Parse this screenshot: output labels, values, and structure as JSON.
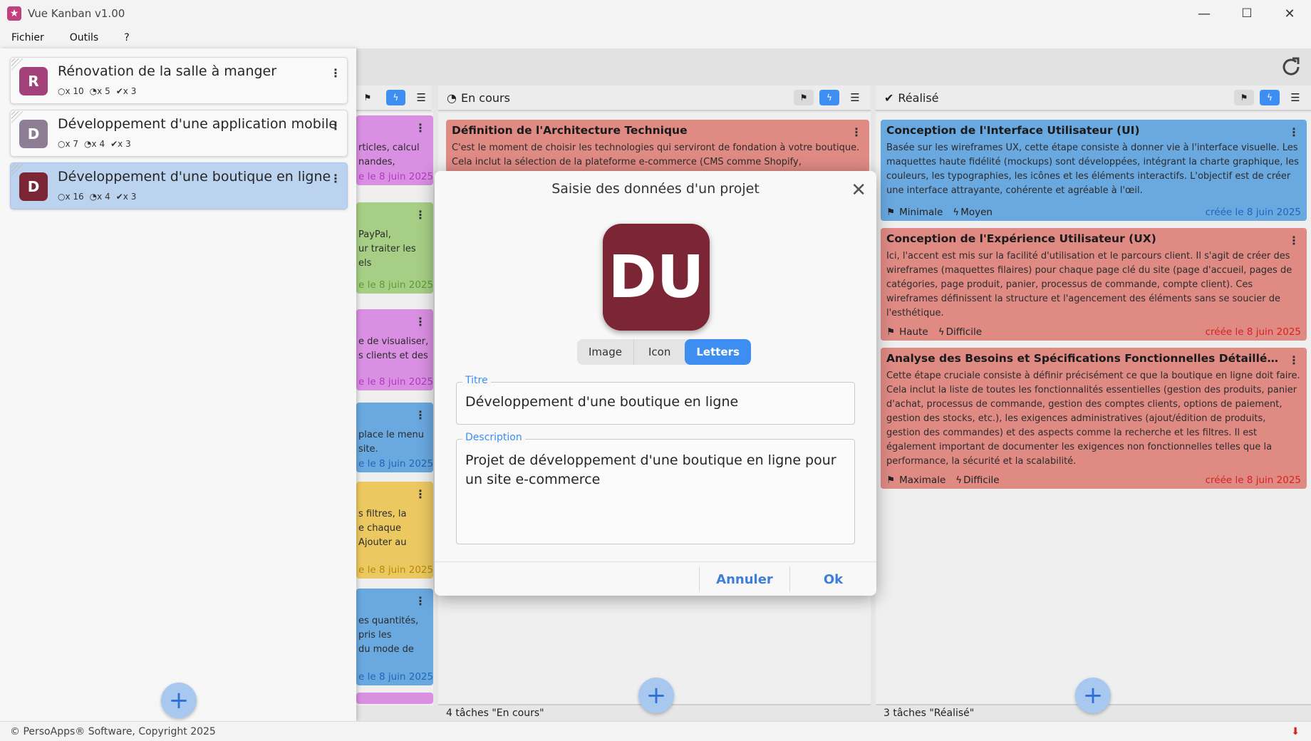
{
  "window": {
    "title": "Vue Kanban v1.00",
    "minimize": "—",
    "maximize": "☐",
    "close": "✕"
  },
  "menu": [
    "Fichier",
    "Outils",
    "?"
  ],
  "statusbar": {
    "text": "© PersoApps® Software, Copyright 2025"
  },
  "projects": [
    {
      "letter": "R",
      "title": "Rénovation de la salle à manger",
      "todo": "x 10",
      "doing": "x 5",
      "done": "x 3",
      "color": "#a3427a"
    },
    {
      "letter": "D",
      "title": "Développement d'une application mobile",
      "todo": "x 7",
      "doing": "x 4",
      "done": "x 3",
      "color": "#8e7e95"
    },
    {
      "letter": "D",
      "title": "Développement d'une boutique en ligne",
      "todo": "x 16",
      "doing": "x 4",
      "done": "x 3",
      "color": "#7b2535"
    }
  ],
  "left_cards": [
    {
      "text1": "rticles, calcul",
      "text2": "nandes,",
      "date": "e le 8 juin 2025",
      "color": "#d98fe2",
      "datecolor": "#b33ac4"
    },
    {
      "text1": "PayPal,",
      "text2": "ur traiter les",
      "text3": "els",
      "date": "e le 8 juin 2025",
      "color": "#a6cf85",
      "datecolor": "#5e9c33"
    },
    {
      "text1": "e de visualiser,",
      "text2": "s clients et des",
      "date": "e le 8 juin 2025",
      "color": "#d98fe2",
      "datecolor": "#b33ac4"
    },
    {
      "text1": "place le menu",
      "text2": "site.",
      "date": "e le 8 juin 2025",
      "color": "#6aa8e0",
      "datecolor": "#1f67b7"
    },
    {
      "text1": "s filtres, la",
      "text2": "e chaque",
      "text3": "Ajouter au",
      "date": "e le 8 juin 2025",
      "color": "#ecc861",
      "datecolor": "#b88a09"
    },
    {
      "text1": "es quantités,",
      "text2": "pris les",
      "text3": "du mode de",
      "date": "e le 8 juin 2025",
      "color": "#6aa8e0",
      "datecolor": "#1f67b7"
    }
  ],
  "columns": {
    "en_cours": {
      "title": "En cours",
      "footer": "4 tâches \"En cours\""
    },
    "realise": {
      "title": "Réalisé",
      "footer": "3 tâches \"Réalisé\""
    }
  },
  "cards_en_cours": [
    {
      "title": "Définition de l'Architecture Technique",
      "desc": "C'est le moment de choisir les technologies qui serviront de fondation à votre boutique. Cela inclut la sélection de la plateforme e-commerce (CMS comme Shopify,",
      "color": "#e08a84"
    }
  ],
  "cards_realise": [
    {
      "title": "Conception de l'Interface Utilisateur (UI)",
      "desc": "Basée sur les wireframes UX, cette étape consiste à donner vie à l'interface visuelle. Les maquettes haute fidélité (mockups) sont développées, intégrant la charte graphique, les couleurs, les typographies, les icônes et les éléments interactifs. L'objectif est de créer une interface attrayante, cohérente et agréable à l'œil.",
      "priority": "Minimale",
      "difficulty": "Moyen",
      "date": "créée le 8 juin 2025",
      "color": "#6aa8e0",
      "datecolor": "#1f67b7"
    },
    {
      "title": "Conception de l'Expérience Utilisateur (UX)",
      "desc": "Ici, l'accent est mis sur la facilité d'utilisation et le parcours client. Il s'agit de créer des wireframes (maquettes filaires) pour chaque page clé du site (page d'accueil, pages de catégories, page produit, panier, processus de commande, compte client). Ces wireframes définissent la structure et l'agencement des éléments sans se soucier de l'esthétique.",
      "priority": "Haute",
      "difficulty": "Difficile",
      "date": "créée le 8 juin 2025",
      "color": "#e08a84",
      "datecolor": "#d42323"
    },
    {
      "title": "Analyse des Besoins et Spécifications Fonctionnelles Détaillées (S...",
      "desc": "Cette étape cruciale consiste à définir précisément ce que la boutique en ligne doit faire. Cela inclut la liste de toutes les fonctionnalités essentielles (gestion des produits, panier d'achat, processus de commande, gestion des comptes clients, options de paiement, gestion des stocks, etc.), les exigences administratives (ajout/édition de produits, gestion des commandes) et des aspects comme la recherche et les filtres. Il est également important de documenter les exigences non fonctionnelles telles que la performance, la sécurité et la scalabilité.",
      "priority": "Maximale",
      "difficulty": "Difficile",
      "date": "créée le 8 juin 2025",
      "color": "#e08a84",
      "datecolor": "#d42323"
    }
  ],
  "modal": {
    "title": "Saisie des données d'un projet",
    "avatar_letters": "DU",
    "tabs": [
      "Image",
      "Icon",
      "Letters"
    ],
    "selected_tab": "Letters",
    "title_label": "Titre",
    "title_value": "Développement d'une boutique en ligne",
    "desc_label": "Description",
    "desc_value": "Projet de développement d'une boutique en ligne pour un site e-commerce",
    "cancel": "Annuler",
    "ok": "Ok"
  },
  "fab_symbol": "+",
  "colors": {
    "accent": "#3d8ef0",
    "selected_project": "#bcd3f0"
  }
}
